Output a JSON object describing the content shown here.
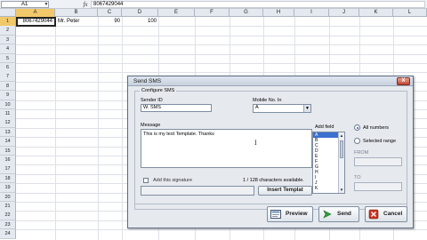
{
  "formula_bar": {
    "name_box": "A1",
    "fx": "fx",
    "value": "8067429044"
  },
  "columns": [
    "A",
    "B",
    "C",
    "D",
    "E",
    "F",
    "G",
    "H",
    "I",
    "J",
    "K",
    "L"
  ],
  "rows": [
    "1",
    "2",
    "3",
    "4",
    "5",
    "6",
    "7",
    "8",
    "9",
    "10",
    "11",
    "12",
    "13",
    "14",
    "15",
    "16",
    "17",
    "18",
    "19",
    "20",
    "21",
    "22",
    "23",
    "24"
  ],
  "cells": {
    "a1": "8067429044",
    "b1": "Mr. Peter",
    "c1": "90",
    "d1": "100"
  },
  "dialog": {
    "title": "Send SMS",
    "close_label": "X",
    "group_label": "Configure SMS",
    "sender_id_label": "Sender ID",
    "sender_id_value": "W. SMS",
    "mobile_label": "Mobile No. In",
    "mobile_value": "A",
    "message_label": "Message",
    "message_text": "This is my test Template. Thanks",
    "add_field_label": "Add field",
    "add_field_items": [
      "A",
      "B",
      "C",
      "D",
      "E",
      "F",
      "G",
      "H",
      "I",
      "J",
      "K"
    ],
    "all_numbers_label": "All numbers",
    "selected_range_label": "Selected range",
    "from_label": "FROM",
    "to_label": "TO",
    "signature_label": "Add this signature",
    "char_count": "1 / 128 characters available.",
    "insert_template_label": "Insert Templat",
    "preview_label": "Preview",
    "send_label": "Send",
    "cancel_label": "Cancel"
  },
  "colors": {
    "selection": "#f2c96a",
    "send_green": "#2e9e3a",
    "cancel_red": "#c8321e"
  }
}
